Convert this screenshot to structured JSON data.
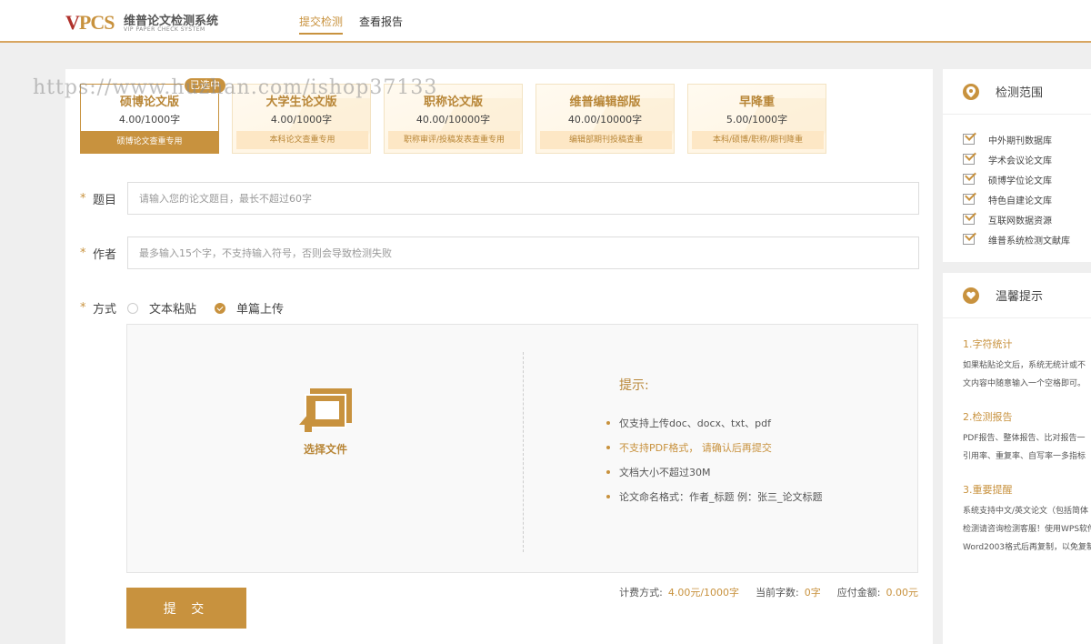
{
  "header": {
    "logo_mark_v": "V",
    "logo_mark_rest": "PCS",
    "logo_name": "维普论文检测系统",
    "logo_sub": "VIP PAPER CHECK SYSTEM",
    "nav": [
      {
        "label": "提交检测"
      },
      {
        "label": "查看报告"
      }
    ]
  },
  "watermark": "https://www.huzhan.com/ishop37133",
  "versions": {
    "selected_badge": "已选中",
    "items": [
      {
        "name": "硕博论文版",
        "price": "4.00/1000字",
        "desc": "硕博论文查重专用"
      },
      {
        "name": "大学生论文版",
        "price": "4.00/1000字",
        "desc": "本科论文查重专用"
      },
      {
        "name": "职称论文版",
        "price": "40.00/10000字",
        "desc": "职称审评/投稿发表查重专用"
      },
      {
        "name": "维普编辑部版",
        "price": "40.00/10000字",
        "desc": "编辑部期刊投稿查重"
      },
      {
        "name": "早降重",
        "price": "5.00/1000字",
        "desc": "本科/硕博/职称/期刊降重"
      }
    ]
  },
  "form": {
    "required_mark": "*",
    "title_label": "题目",
    "title_placeholder": "请输入您的论文题目，最长不超过60字",
    "author_label": "作者",
    "author_placeholder": "最多输入15个字，不支持输入符号，否则会导致检测失败",
    "mode_label": "方式",
    "mode_options": [
      {
        "label": "文本粘贴",
        "checked": false
      },
      {
        "label": "单篇上传",
        "checked": true
      }
    ]
  },
  "upload": {
    "choose_label": "选择文件",
    "tips_title": "提示:",
    "tips": [
      "仅支持上传doc、docx、txt、pdf",
      "不支持PDF格式， 请确认后再提交",
      "文档大小不超过30M",
      "论文命名格式：作者_标题 例：张三_论文标题"
    ]
  },
  "submit_label": "提 交",
  "billing": {
    "method_label": "计费方式:",
    "method_value": "4.00元/1000字",
    "count_label": "当前字数:",
    "count_value": "0字",
    "amount_label": "应付金额:",
    "amount_value": "0.00元"
  },
  "side_scope": {
    "title": "检测范围",
    "items": [
      "中外期刊数据库",
      "学术会议论文库",
      "硕博学位论文库",
      "特色自建论文库",
      "互联网数据资源",
      "维普系统检测文献库"
    ]
  },
  "side_tips": {
    "title": "温馨提示",
    "blocks": [
      {
        "h": "1.字符统计",
        "lines": [
          "如果粘贴论文后，系统无统计或不",
          "文内容中随意输入一个空格即可。"
        ]
      },
      {
        "h": "2.检测报告",
        "lines": [
          "PDF报告、整体报告、比对报告一",
          "引用率、重复率、自写率一多指标"
        ]
      },
      {
        "h": "3.重要提醒",
        "lines": [
          "系统支持中文/英文论文（包括简体",
          "检测请咨询检测客服！使用WPS软件",
          "Word2003格式后再复制，以免复制"
        ]
      }
    ]
  },
  "colors": {
    "accent": "#c8923e",
    "logo_red": "#b0312b",
    "badge_bg": "#fde7c5"
  }
}
